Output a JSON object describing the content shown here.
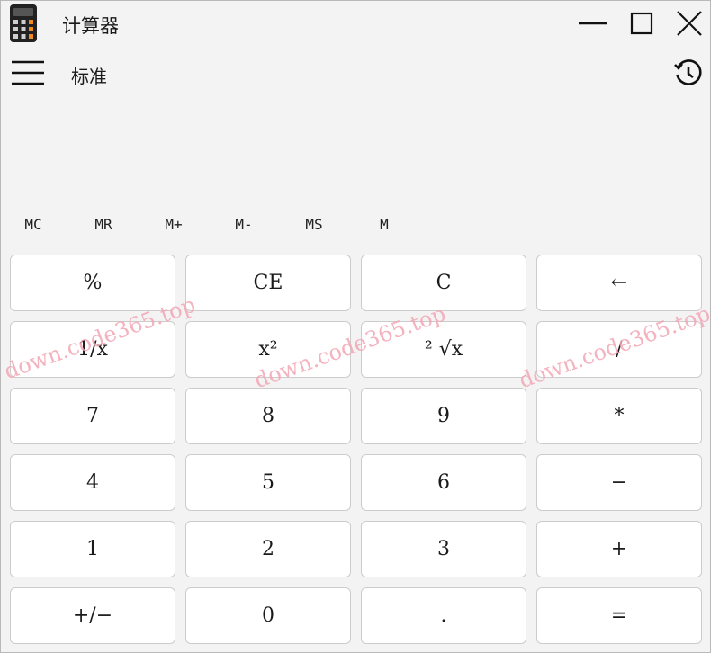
{
  "window": {
    "title": "计算器"
  },
  "header": {
    "mode": "标准"
  },
  "display": {
    "value": ""
  },
  "memory": [
    "MC",
    "MR",
    "M+",
    "M-",
    "MS",
    "M"
  ],
  "keypad": {
    "rows": [
      [
        "%",
        "CE",
        "C",
        "←"
      ],
      [
        "1/x",
        "x²",
        "² √x",
        "/"
      ],
      [
        "7",
        "8",
        "9",
        "*"
      ],
      [
        "4",
        "5",
        "6",
        "−"
      ],
      [
        "1",
        "2",
        "3",
        "+"
      ],
      [
        "+/−",
        "0",
        ".",
        "="
      ]
    ]
  },
  "watermark": "down.code365.top",
  "colors": {
    "window_bg": "#f3f3f3",
    "key_bg": "#ffffff",
    "key_border": "#cccccc",
    "watermark": "#f2a6b4"
  },
  "icons": {
    "app": "calculator-icon",
    "menu": "hamburger-menu-icon",
    "history": "history-clock-icon",
    "minimize": "minimize-icon",
    "maximize": "maximize-icon",
    "close": "close-icon"
  }
}
